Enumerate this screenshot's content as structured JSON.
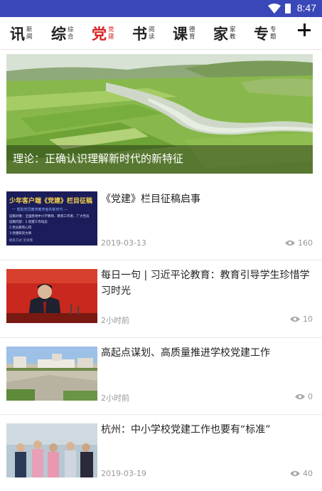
{
  "status_bar": {
    "time": "8:47"
  },
  "tabs": [
    {
      "big": "讯",
      "small": "新闻",
      "active": false
    },
    {
      "big": "综",
      "small": "综合",
      "active": false
    },
    {
      "big": "党",
      "small": "党建",
      "active": true
    },
    {
      "big": "书",
      "small": "阅读",
      "active": false
    },
    {
      "big": "课",
      "small": "德育",
      "active": false
    },
    {
      "big": "家",
      "small": "家教",
      "active": false
    },
    {
      "big": "专",
      "small": "专题",
      "active": false
    }
  ],
  "banner": {
    "title": "理论：正确认识理解新时代的新特征"
  },
  "news": [
    {
      "headline": "《党建》栏目征稿启事",
      "date": "2019-03-13",
      "views": "160"
    },
    {
      "headline": "每日一句 | 习近平论教育：教育引导学生珍惜学习时光",
      "date": "2小时前",
      "views": "10"
    },
    {
      "headline": "高起点谋划、高质量推进学校党建工作",
      "date": "2小时前",
      "views": "0"
    },
    {
      "headline": "杭州：中小学校党建工作也要有“标准”",
      "date": "2019-03-19",
      "views": "40"
    }
  ],
  "thumb1": {
    "title": "少年客户端《党建》栏目征稿",
    "subtitle": "一 帮助党员教育教育者的新时代 —",
    "lines": [
      "征稿对象：全国各地中小学教师、教育工作者、广大党员",
      "征稿内容：1.党建工作动态",
      "2.党员教育心得",
      "3.党建研究文章"
    ],
    "footer": "联系方式 见详情"
  },
  "colors": {
    "accent": "#d62222",
    "statusbar": "#3a47b8"
  }
}
